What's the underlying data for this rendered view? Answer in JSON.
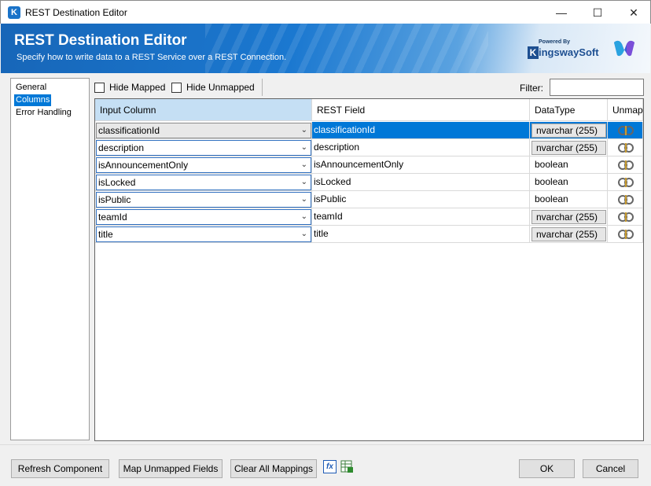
{
  "window": {
    "title": "REST Destination Editor",
    "app_icon": "K",
    "controls": [
      "minimize-icon",
      "maximize-icon",
      "close-icon"
    ]
  },
  "banner": {
    "title": "REST Destination Editor",
    "subtitle": "Specify how to write data to a REST Service over a REST Connection.",
    "logo_powered": "Powered By",
    "logo_k": "K",
    "logo_name": "ingswaySoft"
  },
  "nav": {
    "items": [
      {
        "label": "General"
      },
      {
        "label": "Columns",
        "selected": true
      },
      {
        "label": "Error Handling"
      }
    ]
  },
  "toolbar": {
    "hide_mapped": "Hide Mapped",
    "hide_unmapped": "Hide Unmapped",
    "filter_label": "Filter:",
    "filter_value": ""
  },
  "grid": {
    "headers": {
      "input": "Input Column",
      "rest": "REST Field",
      "type": "DataType",
      "unmap": "Unmap"
    },
    "rows": [
      {
        "input": "classificationId",
        "rest": "classificationId",
        "type": "nvarchar (255)",
        "boxed": true,
        "selected": true
      },
      {
        "input": "description",
        "rest": "description",
        "type": "nvarchar (255)",
        "boxed": true
      },
      {
        "input": "isAnnouncementOnly",
        "rest": "isAnnouncementOnly",
        "type": "boolean",
        "boxed": false
      },
      {
        "input": "isLocked",
        "rest": "isLocked",
        "type": "boolean",
        "boxed": false
      },
      {
        "input": "isPublic",
        "rest": "isPublic",
        "type": "boolean",
        "boxed": false
      },
      {
        "input": "teamId",
        "rest": "teamId",
        "type": "nvarchar (255)",
        "boxed": true
      },
      {
        "input": "title",
        "rest": "title",
        "type": "nvarchar (255)",
        "boxed": true
      }
    ]
  },
  "buttons": {
    "refresh": "Refresh Component",
    "map_unmapped": "Map Unmapped Fields",
    "clear_all": "Clear All Mappings",
    "fx": "fx",
    "ok": "OK",
    "cancel": "Cancel"
  },
  "colors": {
    "accent": "#0078d7",
    "banner": "#1b78d0",
    "header_selected": "#c5dff4"
  }
}
